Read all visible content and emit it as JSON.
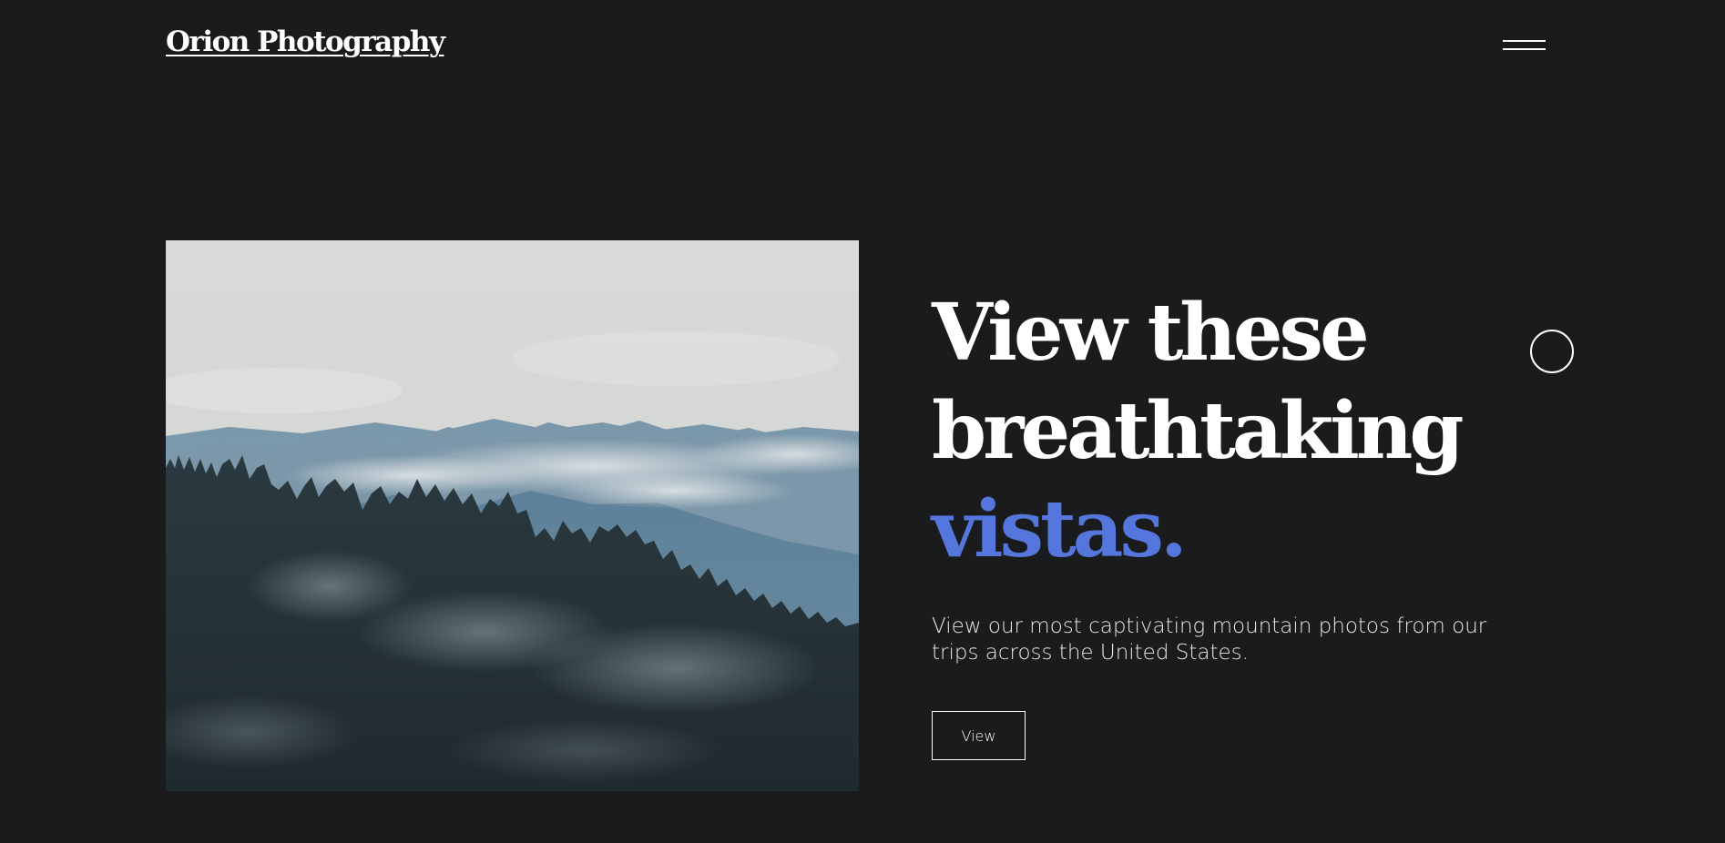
{
  "header": {
    "logo_text": "Orion Photography",
    "menu_icon": "hamburger-menu-icon"
  },
  "hero": {
    "image_icon": "mountain-forest-photo",
    "headline": {
      "line1": "View these",
      "line2": "breathtaking",
      "accent": "vistas."
    },
    "description": "View our most captivating mountain photos from our trips across the United States.",
    "button_label": "View"
  },
  "colors": {
    "background": "#1a1b1d",
    "text": "#ffffff",
    "accent": "#5577dd"
  }
}
